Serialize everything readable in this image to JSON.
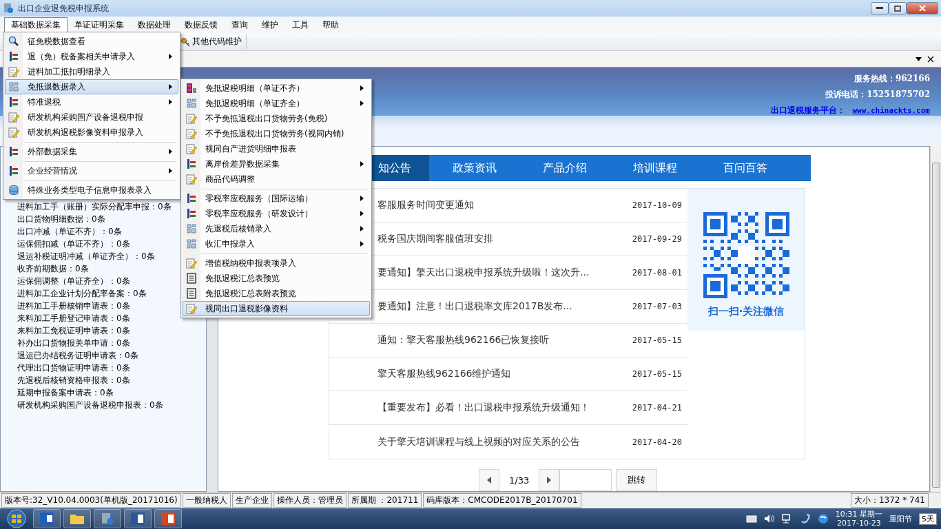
{
  "window": {
    "title": "出口企业退免税申报系统"
  },
  "menu_bar": [
    {
      "label": "基础数据采集",
      "selected": true
    },
    {
      "label": "单证证明采集",
      "selected": false
    },
    {
      "label": "数据处理",
      "selected": false
    },
    {
      "label": "数据反馈",
      "selected": false
    },
    {
      "label": "查询",
      "selected": false
    },
    {
      "label": "维护",
      "selected": false
    },
    {
      "label": "工具",
      "selected": false
    },
    {
      "label": "帮助",
      "selected": false
    }
  ],
  "toolbar": [
    {
      "label": "其他代码维护"
    }
  ],
  "menu": [
    {
      "label": "征免税数据查看",
      "kind": "search",
      "submenu": false,
      "selected": false,
      "separator_before": false
    },
    {
      "label": "退（免）税备案相关申请录入",
      "kind": "tree",
      "submenu": true,
      "selected": false,
      "separator_before": false
    },
    {
      "label": "进料加工抵扣明细录入",
      "kind": "edit",
      "submenu": false,
      "selected": false,
      "separator_before": false
    },
    {
      "label": "免抵退数据录入",
      "kind": "module",
      "submenu": true,
      "selected": true,
      "separator_before": false
    },
    {
      "label": "特准退税",
      "kind": "tree",
      "submenu": true,
      "selected": false,
      "separator_before": false
    },
    {
      "label": "研发机构采购国产设备退税申报",
      "kind": "edit",
      "submenu": false,
      "selected": false,
      "separator_before": false
    },
    {
      "label": "研发机构退税影像资料申报录入",
      "kind": "edit",
      "submenu": false,
      "selected": false,
      "separator_before": false
    },
    {
      "label": "外部数据采集",
      "kind": "tree",
      "submenu": true,
      "selected": false,
      "separator_before": true
    },
    {
      "label": "企业经营情况",
      "kind": "tree",
      "submenu": true,
      "selected": false,
      "separator_before": true
    },
    {
      "label": "特殊业务类型电子信息申报表录入",
      "kind": "database",
      "submenu": false,
      "selected": false,
      "separator_before": true
    }
  ],
  "submenu": [
    {
      "label": "免抵退税明细（单证不齐）",
      "kind": "report",
      "submenu": true,
      "selected": false,
      "separator_before": false
    },
    {
      "label": "免抵退税明细（单证齐全）",
      "kind": "module",
      "submenu": true,
      "selected": false,
      "separator_before": false
    },
    {
      "label": "不予免抵退税出口货物劳务(免税)",
      "kind": "edit",
      "submenu": false,
      "selected": false,
      "separator_before": false
    },
    {
      "label": "不予免抵退税出口货物劳务(视同内销)",
      "kind": "edit",
      "submenu": false,
      "selected": false,
      "separator_before": false
    },
    {
      "label": "视同自产进货明细申报表",
      "kind": "edit",
      "submenu": false,
      "selected": false,
      "separator_before": false
    },
    {
      "label": "离岸价差异数据采集",
      "kind": "tree",
      "submenu": true,
      "selected": false,
      "separator_before": false
    },
    {
      "label": "商品代码调整",
      "kind": "edit",
      "submenu": false,
      "selected": false,
      "separator_before": false
    },
    {
      "label": "零税率应税服务（国际运输）",
      "kind": "tree",
      "submenu": true,
      "selected": false,
      "separator_before": true
    },
    {
      "label": "零税率应税服务（研发设计）",
      "kind": "tree",
      "submenu": true,
      "selected": false,
      "separator_before": false
    },
    {
      "label": "先退税后核销录入",
      "kind": "module",
      "submenu": true,
      "selected": false,
      "separator_before": false
    },
    {
      "label": "收汇申报录入",
      "kind": "module",
      "submenu": true,
      "selected": false,
      "separator_before": false
    },
    {
      "label": "增值税纳税申报表项录入",
      "kind": "edit",
      "submenu": false,
      "selected": false,
      "separator_before": true
    },
    {
      "label": "免抵退税汇总表预览",
      "kind": "sheet",
      "submenu": false,
      "selected": false,
      "separator_before": false
    },
    {
      "label": "免抵退税汇总表附表预览",
      "kind": "sheet",
      "submenu": false,
      "selected": false,
      "separator_before": false
    },
    {
      "label": "视同出口退税影像资料",
      "kind": "edit",
      "submenu": false,
      "selected": true,
      "separator_before": false
    }
  ],
  "banner": {
    "hotline": "服务热线：962166",
    "complaint": "投诉电话：15251875702",
    "platform_label": "出口退税服务平台：",
    "platform_link": "www.chinackts.com"
  },
  "left_panel": {
    "items": [
      "进料加工手（账册）实际分配率申报：0条",
      "出口货物明细数据：0条",
      "出口冲减（单证不齐）：0条",
      "运保佣扣减（单证不齐）：0条",
      "退运补税证明冲减（单证齐全）：0条",
      "收齐前期数据：0条",
      "运保佣调整（单证齐全）：0条",
      "进料加工企业计划分配率备案：0条",
      "进料加工手册核销申请表：0条",
      "来料加工手册登记申请表：0条",
      "来料加工免税证明申请表：0条",
      "补办出口货物报关单申请：0条",
      "退运已办结税务证明申请表：0条",
      "代理出口货物证明申请表：0条",
      "先退税后核销资格申报表：0条",
      "延期申报备案申请表：0条",
      "研发机构采购国产设备退税申报表：0条"
    ]
  },
  "news_tabs": [
    {
      "label": "知公告",
      "selected": true
    },
    {
      "label": "政策资讯",
      "selected": false
    },
    {
      "label": "产品介绍",
      "selected": false
    },
    {
      "label": "培训课程",
      "selected": false
    },
    {
      "label": "百问百答",
      "selected": false
    }
  ],
  "news": [
    {
      "title": "客服服务时间变更通知",
      "date": "2017-10-09"
    },
    {
      "title": "税务国庆期间客服值班安排",
      "date": "2017-09-29"
    },
    {
      "title": "要通知】擎天出口退税申报系统升级啦！这次升...",
      "date": "2017-08-01"
    },
    {
      "title": "要通知】注意！出口退税率文库2017B发布...",
      "date": "2017-07-03"
    },
    {
      "title": "通知：擎天客服热线962166已恢复接听",
      "date": "2017-05-15"
    },
    {
      "title": "擎天客服热线962166维护通知",
      "date": "2017-05-15"
    },
    {
      "title": "【重要发布】必看！出口退税申报系统升级通知！",
      "date": "2017-04-21"
    },
    {
      "title": "关于擎天培训课程与线上视频的对应关系的公告",
      "date": "2017-04-20"
    }
  ],
  "qr": {
    "caption": "扫一扫·关注微信"
  },
  "pager": {
    "page": "1/33",
    "jump": "跳转"
  },
  "status_bar": [
    "版本号:32_V10.04.0003(单机版_20171016)",
    "一般纳税人",
    "生产企业",
    "操作人员：管理员",
    "所属期 ：201711",
    "码库版本：CMCODE2017B_20170701"
  ],
  "status_size": "大小：1372 * 741",
  "taskbar": {
    "time": "10:31 星期一",
    "date": "2017-10-23",
    "holiday": "重阳节",
    "days": "5天"
  }
}
